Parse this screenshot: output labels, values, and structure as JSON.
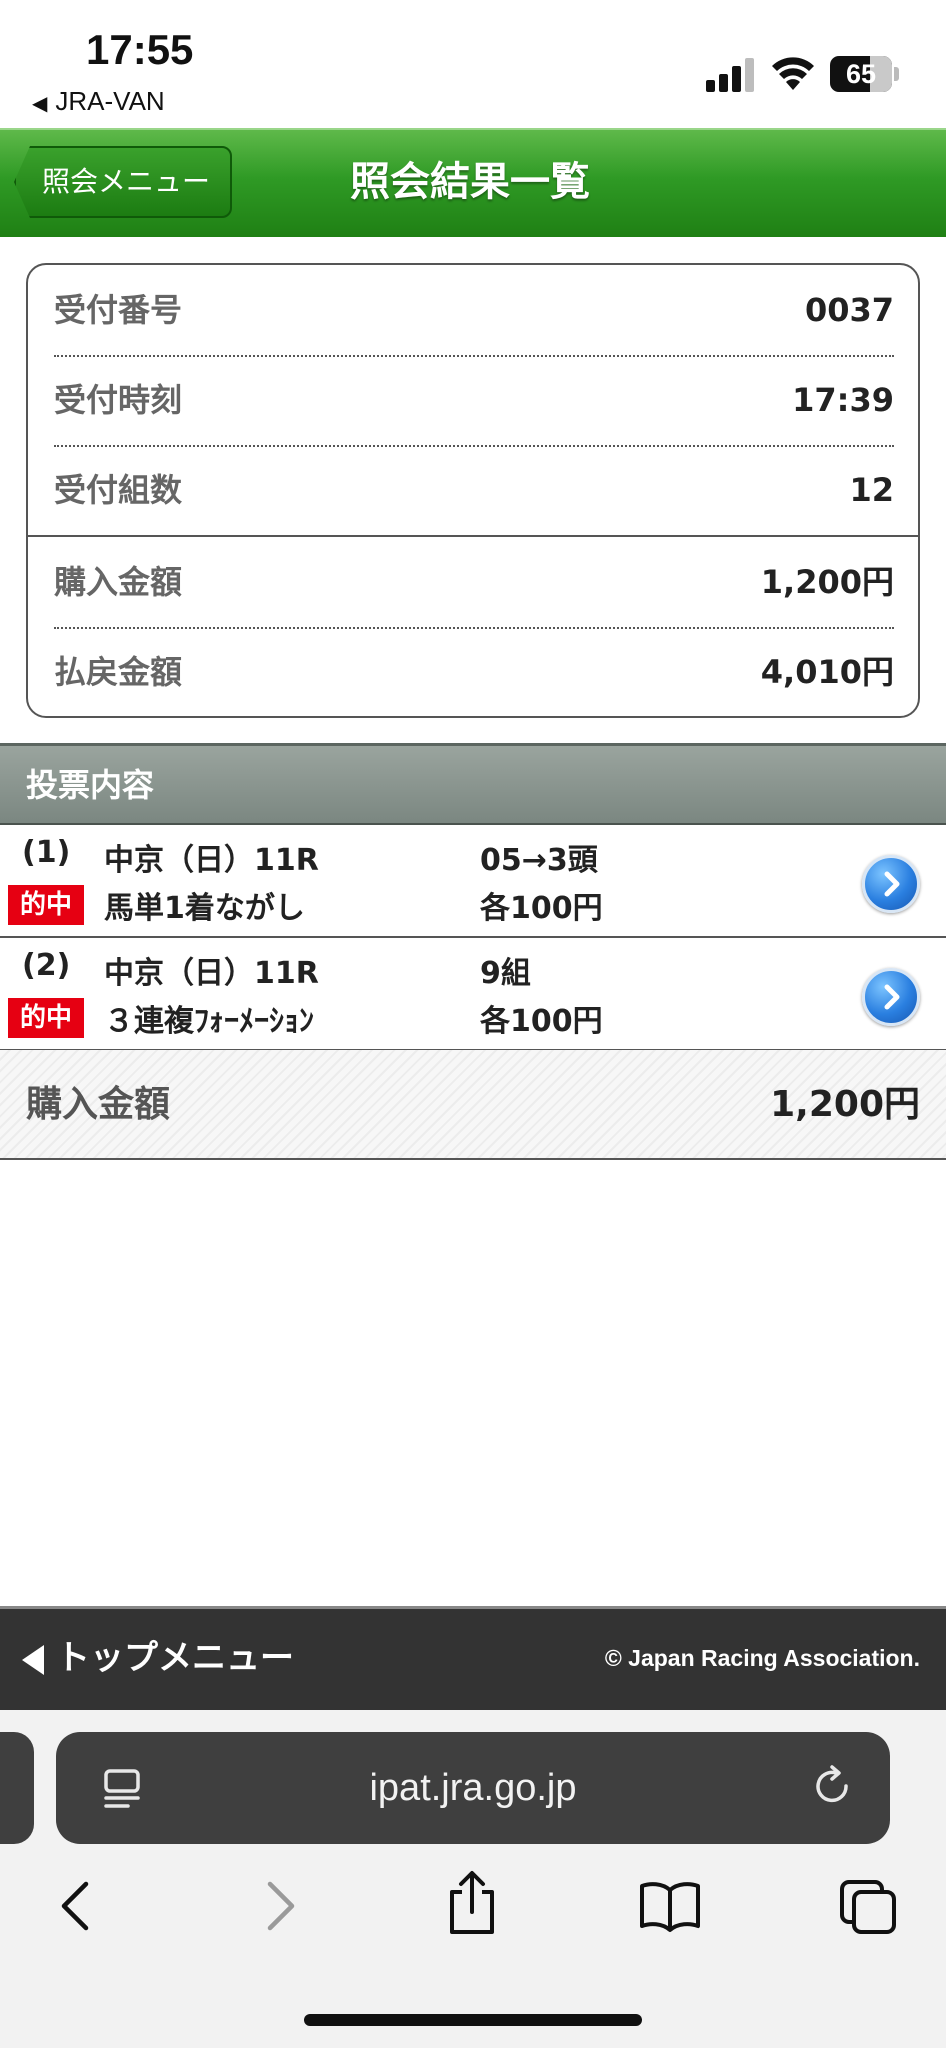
{
  "status_bar": {
    "time": "17:55",
    "back_app": "JRA-VAN",
    "battery_percent": 65
  },
  "header": {
    "back_label": "照会メニュー",
    "title": "照会結果一覧",
    "color": "#2f9a25"
  },
  "summary": {
    "rows": [
      {
        "label": "受付番号",
        "value": "0037"
      },
      {
        "label": "受付時刻",
        "value": "17:39"
      },
      {
        "label": "受付組数",
        "value": "12"
      },
      {
        "label": "購入金額",
        "value": "1,200円"
      },
      {
        "label": "払戻金額",
        "value": "4,010円"
      }
    ]
  },
  "votes": {
    "section_title": "投票内容",
    "items": [
      {
        "num": "(1)",
        "race": "中京（日）11R",
        "hit": "的中",
        "type": "馬単1着ながし",
        "combo": "05→3頭",
        "amount": "各100円"
      },
      {
        "num": "(2)",
        "race": "中京（日）11R",
        "hit": "的中",
        "type": "３連複ﾌｫｰﾒｰｼｮﾝ",
        "combo": "9組",
        "amount": "各100円"
      }
    ]
  },
  "total": {
    "label": "購入金額",
    "value": "1,200円"
  },
  "footer": {
    "top_menu": "トップメニュー",
    "copyright": "© Japan Racing Association."
  },
  "browser": {
    "url": "ipat.jra.go.jp"
  },
  "colors": {
    "hit_badge": "#e60012",
    "accent_green": "#2f9a25",
    "section_gray": "#8a948f"
  }
}
